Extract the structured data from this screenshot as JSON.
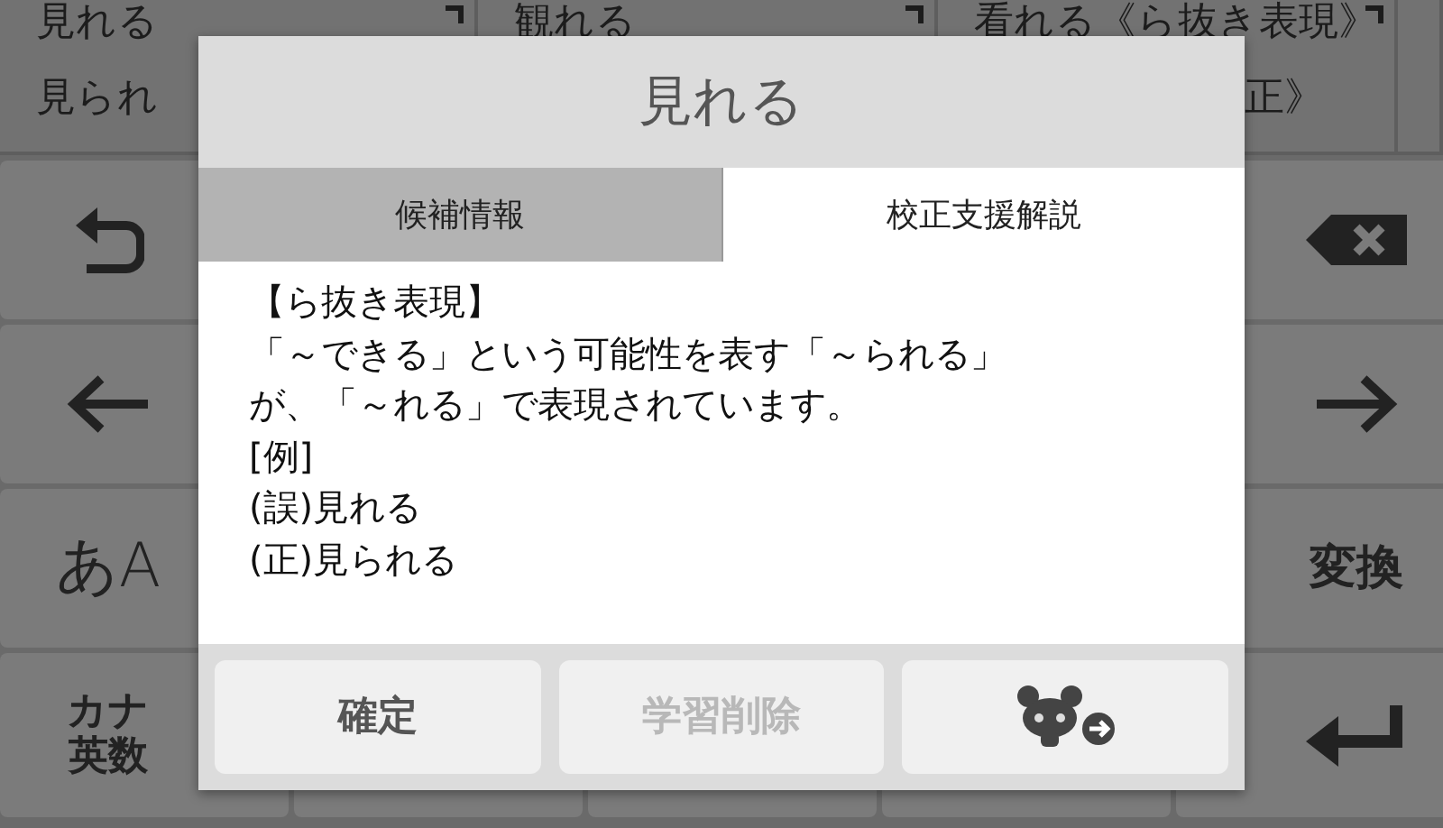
{
  "candidate_bar": {
    "columns": [
      {
        "lines": [
          "見れる",
          "見られ"
        ]
      },
      {
        "lines": [
          "観れる"
        ]
      },
      {
        "lines": [
          "看れる《ら抜き表現》",
          "正》"
        ]
      }
    ]
  },
  "keyboard": {
    "left_keys": [
      {
        "kind": "undo"
      },
      {
        "kind": "left"
      },
      {
        "kind": "label",
        "lines": [
          "**あ**A"
        ]
      },
      {
        "kind": "label",
        "lines": [
          "カナ",
          "英数"
        ]
      }
    ],
    "right_keys": [
      {
        "kind": "backspace"
      },
      {
        "kind": "right"
      },
      {
        "kind": "label",
        "lines": [
          "変換"
        ]
      },
      {
        "kind": "enter"
      }
    ]
  },
  "dialog": {
    "title": "見れる",
    "tabs": [
      {
        "label": "候補情報",
        "selected": false
      },
      {
        "label": "校正支援解説",
        "selected": true
      }
    ],
    "body": [
      "【ら抜き表現】",
      "「～できる」という可能性を表す「～られる」が、「～れる」で表現されています。",
      "[例]",
      "(誤)見れる",
      "(正)見られる"
    ],
    "buttons": [
      {
        "kind": "text",
        "label": "確定",
        "disabled": false
      },
      {
        "kind": "text",
        "label": "学習削除",
        "disabled": true
      },
      {
        "kind": "icon",
        "disabled": false
      }
    ]
  }
}
